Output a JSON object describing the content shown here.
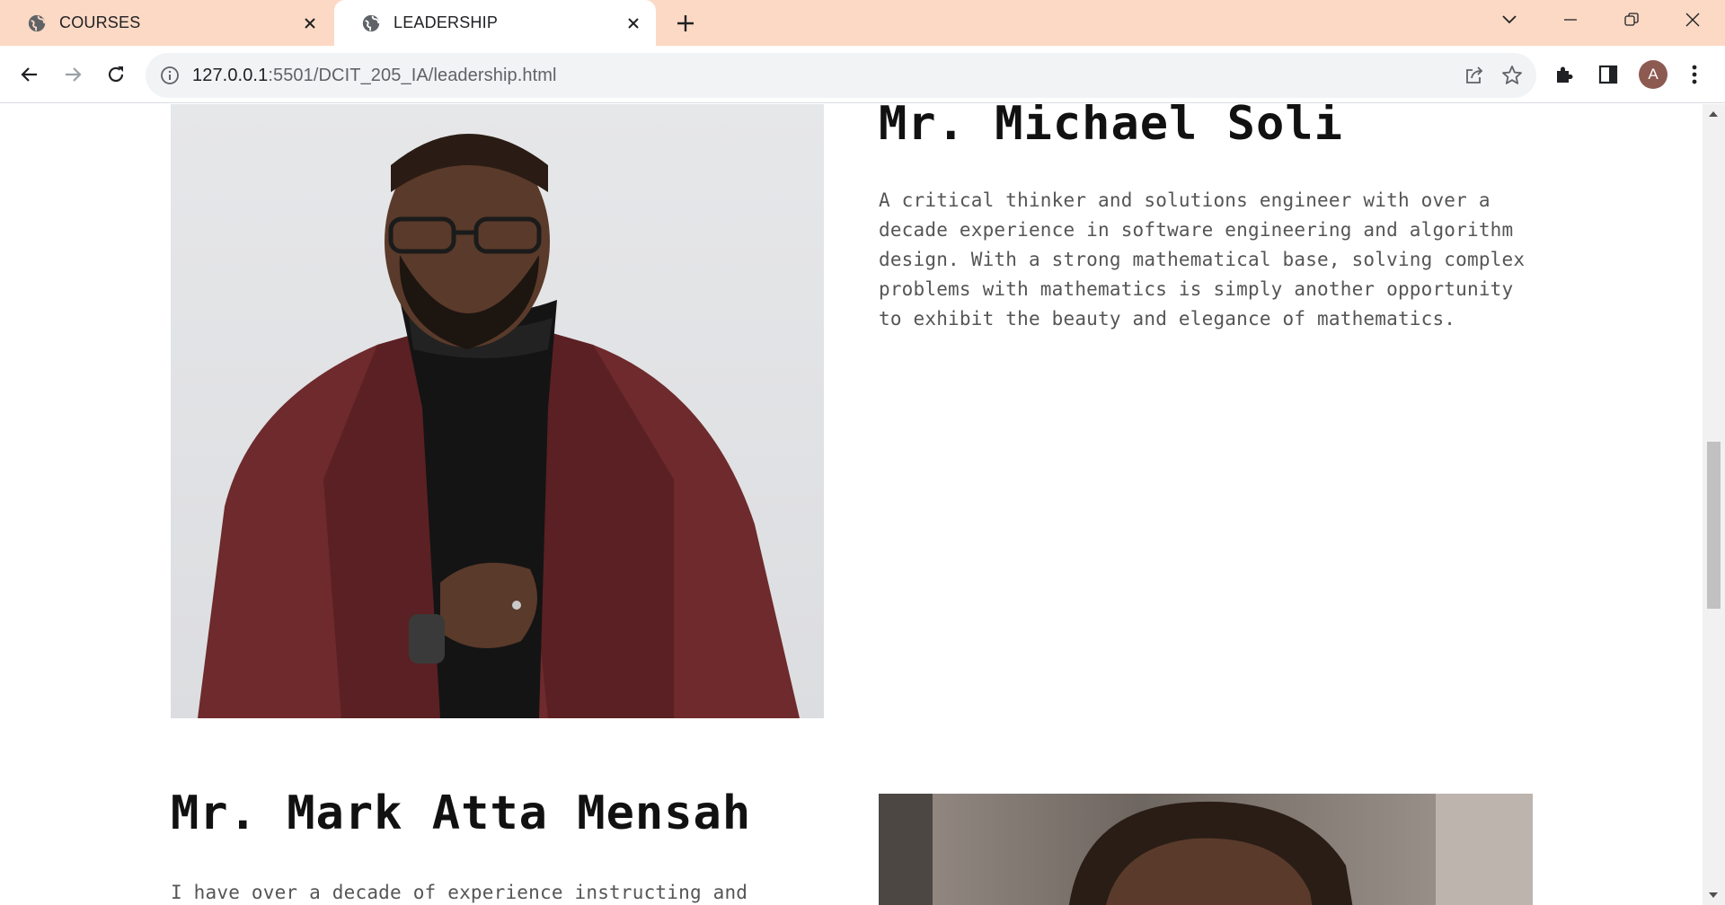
{
  "browser": {
    "tabs": [
      {
        "title": "COURSES",
        "active": false
      },
      {
        "title": "LEADERSHIP",
        "active": true
      }
    ],
    "url_host": "127.0.0.1",
    "url_rest": ":5501/DCIT_205_IA/leadership.html",
    "profile_initial": "A",
    "tab_color": "#fcd9c4"
  },
  "page": {
    "leaders": [
      {
        "name": "Mr. Michael Soli",
        "bio": "A critical thinker and solutions engineer with over a decade experience in software engineering and algorithm design. With a strong mathematical base, solving complex problems with mathematics is simply another opportunity to exhibit the beauty and elegance of mathematics."
      },
      {
        "name": "Mr. Mark Atta Mensah",
        "bio": "I have over a decade of experience instructing and"
      }
    ]
  }
}
